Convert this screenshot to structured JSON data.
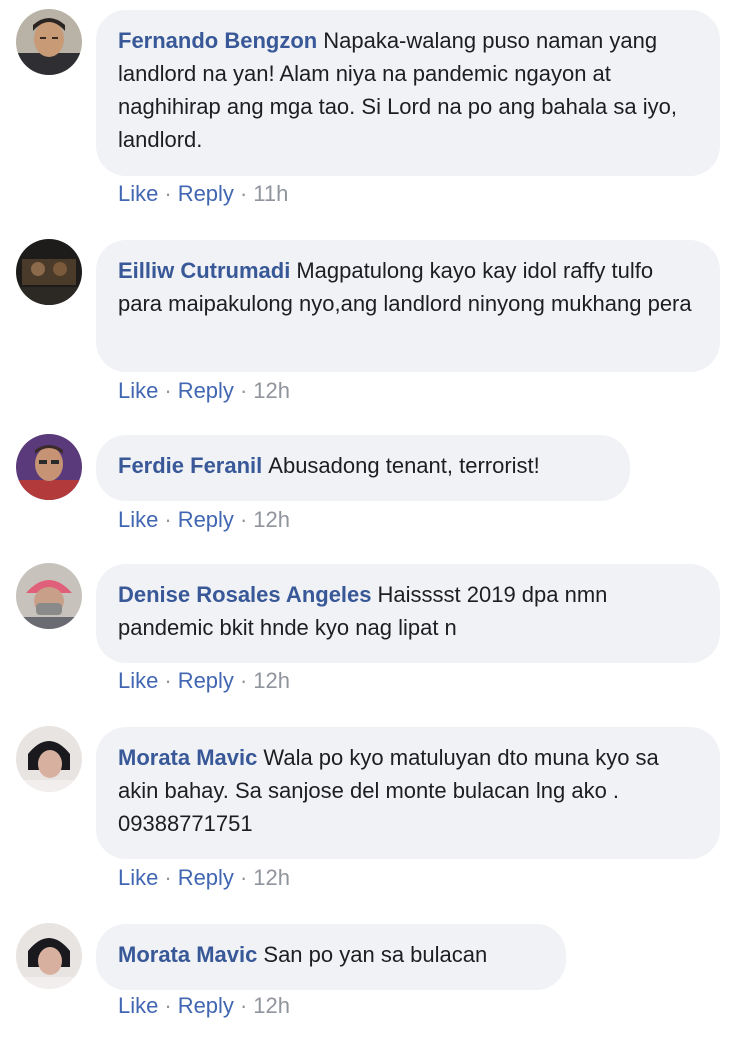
{
  "actions": {
    "like_label": "Like",
    "reply_label": "Reply",
    "separator": "·"
  },
  "comments": [
    {
      "author": "Fernando Bengzon",
      "text": "Napaka-walang puso naman yang landlord na yan! Alam niya na pandemic ngayon at naghihirap ang mga tao. Si Lord na po ang bahala sa iyo, landlord.",
      "time": "11h"
    },
    {
      "author": "Eilliw Cutrumadi",
      "text": "Magpatulong kayo kay idol raffy tulfo para maipakulong nyo,ang landlord ninyong mukhang pera",
      "time": "12h"
    },
    {
      "author": "Ferdie Feranil",
      "text": "Abusadong tenant, terrorist!",
      "time": "12h"
    },
    {
      "author": "Denise Rosales Angeles",
      "text": "Haisssst 2019 dpa nmn pandemic bkit hnde kyo nag lipat n",
      "time": "12h"
    },
    {
      "author": "Morata Mavic",
      "text": "Wala po kyo matuluyan dto muna kyo sa akin bahay. Sa sanjose del monte bulacan lng ako . 09388771751",
      "time": "12h"
    },
    {
      "author": "Morata Mavic",
      "text": "San po yan sa bulacan",
      "time": "12h"
    }
  ]
}
